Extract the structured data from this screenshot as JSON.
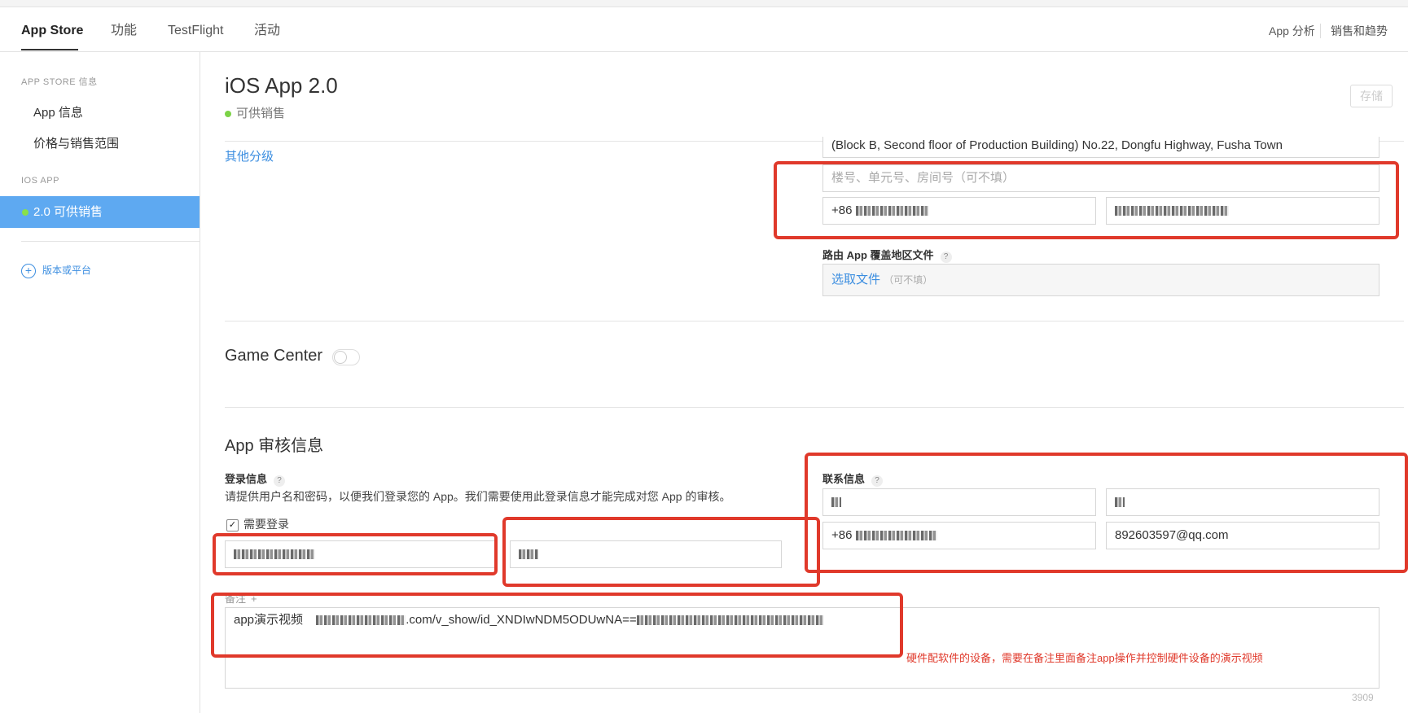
{
  "nav": {
    "tabs": [
      "App Store",
      "功能",
      "TestFlight",
      "活动"
    ],
    "right": [
      "App 分析",
      "销售和趋势"
    ]
  },
  "sidebar": {
    "section1": "APP STORE 信息",
    "item_app_info": "App 信息",
    "item_pricing": "价格与销售范围",
    "section2": "IOS APP",
    "active_version": "2.0 可供销售",
    "add_platform": "版本或平台"
  },
  "header": {
    "title": "iOS App 2.0",
    "status": "可供销售",
    "save": "存储"
  },
  "rating": {
    "other_link": "其他分级"
  },
  "address": {
    "line": "(Block B, Second floor of Production Building) No.22, Dongfu Highway, Fusha Town",
    "placeholder_unit": "楼号、单元号、房间号（可不填）",
    "phone_prefix": "+86"
  },
  "route_file": {
    "label": "路由 App 覆盖地区文件",
    "choose": "选取文件",
    "optional": "（可不填）"
  },
  "game_center": {
    "label": "Game Center"
  },
  "review": {
    "title": "App 审核信息",
    "login_label": "登录信息",
    "login_desc": "请提供用户名和密码，以便我们登录您的 App。我们需要使用此登录信息才能完成对您 App 的审核。",
    "need_login": "需要登录",
    "contact_label": "联系信息",
    "phone_prefix": "+86",
    "email": "892603597@qq.com",
    "notes_label": "备注",
    "notes_prefix": "app演示视频",
    "notes_url_mid": ".com/v_show/id_XNDIwNDM5ODUwNA==",
    "char_count": "3909"
  },
  "annotation": {
    "text": "硬件配软件的设备，需要在备注里面备注app操作并控制硬件设备的演示视频"
  },
  "colors": {
    "accent": "#3c8ee0",
    "sidebar_active": "#5ea9f1",
    "highlight_red": "#e0392b",
    "status_green": "#7cd347"
  }
}
